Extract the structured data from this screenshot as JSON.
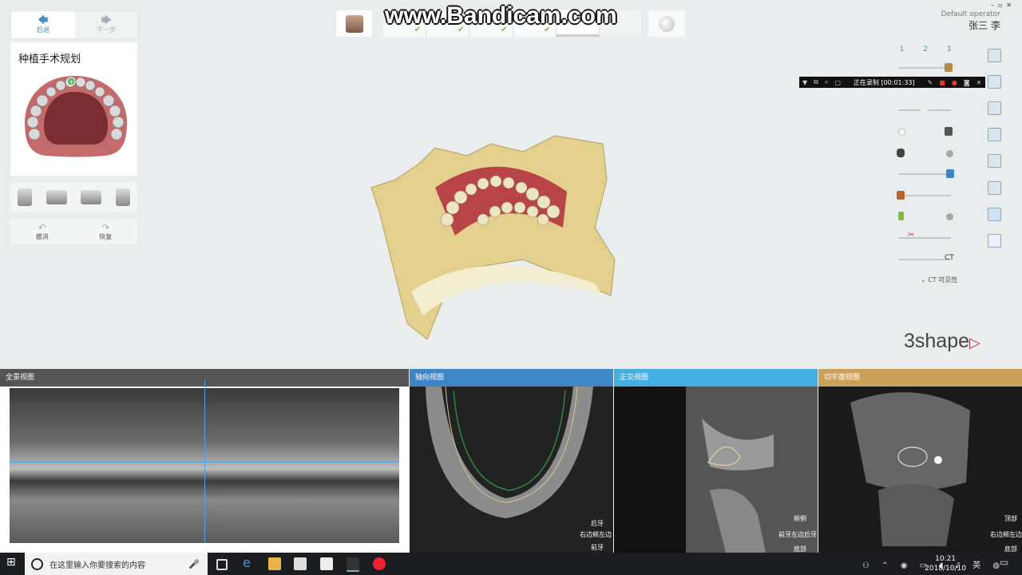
{
  "watermark": "www.Bandicam.com",
  "nav": {
    "back": "后退",
    "next": "下一步"
  },
  "plan_title": "种植手术规划",
  "undo": {
    "undo": "撤消",
    "redo": "恢复"
  },
  "operator": {
    "role": "Default operator",
    "name": "张三 李"
  },
  "recording": {
    "status": "正在录制 [00:01:33]"
  },
  "view_tabs": [
    "1",
    "2",
    "3"
  ],
  "ct_label": "CT",
  "ct_visibility": "CT 可见性",
  "logo": "3shape",
  "panels": [
    {
      "title": "全景视图"
    },
    {
      "title": "轴向视图",
      "labels": [
        "后牙",
        "右边颊左边",
        "前牙"
      ]
    },
    {
      "title": "正交视图",
      "labels": [
        "颊侧",
        "前牙左边后牙",
        "底部"
      ]
    },
    {
      "title": "切平面视图",
      "labels": [
        "顶部",
        "右边颊左边",
        "底部"
      ]
    }
  ],
  "taskbar": {
    "search_placeholder": "在这里输入你要搜索的内容",
    "time": "10:21",
    "date": "2018/10/10"
  },
  "colors": {
    "axial": "#3f86c6",
    "ortho": "#45aee3",
    "cross": "#c8a15a",
    "accent": "#7cbf3c",
    "logo_accent": "#c0304a"
  }
}
